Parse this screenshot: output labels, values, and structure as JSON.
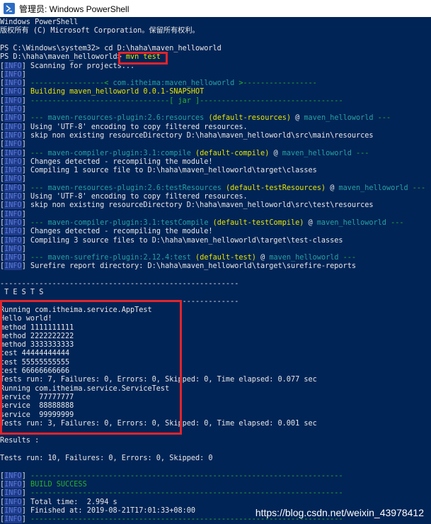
{
  "window": {
    "title": "管理员: Windows PowerShell",
    "icon": "powershell-icon"
  },
  "colors": {
    "background": "#012456",
    "highlight_border": "#e0252b",
    "info_tag": "#5b7bd6",
    "success": "#2ab52a",
    "plugin": "#2aa1a1",
    "goal": "#e6e600"
  },
  "lines": [
    {
      "parts": [
        {
          "t": "Windows PowerShell",
          "c": "w"
        }
      ]
    },
    {
      "parts": [
        {
          "t": "版权所有 (C) Microsoft Corporation。保留所有权利。",
          "c": "w"
        }
      ]
    },
    {
      "parts": [
        {
          "t": "",
          "c": "w"
        }
      ]
    },
    {
      "parts": [
        {
          "t": "PS C:\\Windows\\system32> cd D:\\haha\\maven_helloworld",
          "c": "w"
        }
      ]
    },
    {
      "parts": [
        {
          "t": "PS D:\\haha\\maven_helloworld> ",
          "c": "w"
        },
        {
          "t": "mvn test",
          "c": "y"
        }
      ]
    },
    {
      "parts": [
        {
          "t": "[",
          "c": "w"
        },
        {
          "t": "INFO",
          "c": "info"
        },
        {
          "t": "] Scanning for projects...",
          "c": "w"
        }
      ]
    },
    {
      "parts": [
        {
          "t": "[",
          "c": "w"
        },
        {
          "t": "INFO",
          "c": "info"
        },
        {
          "t": "]",
          "c": "w"
        }
      ]
    },
    {
      "parts": [
        {
          "t": "[",
          "c": "w"
        },
        {
          "t": "INFO",
          "c": "info"
        },
        {
          "t": "] ",
          "c": "w"
        },
        {
          "t": "-----------------< ",
          "c": "g"
        },
        {
          "t": "com.itheima:maven_helloworld",
          "c": "c"
        },
        {
          "t": " >-----------------",
          "c": "g"
        }
      ]
    },
    {
      "parts": [
        {
          "t": "[",
          "c": "w"
        },
        {
          "t": "INFO",
          "c": "info"
        },
        {
          "t": "] ",
          "c": "w"
        },
        {
          "t": "Building maven_helloworld 0.0.1-SNAPSHOT",
          "c": "y"
        }
      ]
    },
    {
      "parts": [
        {
          "t": "[",
          "c": "w"
        },
        {
          "t": "INFO",
          "c": "info"
        },
        {
          "t": "] ",
          "c": "w"
        },
        {
          "t": "--------------------------------[ jar ]---------------------------------",
          "c": "g"
        }
      ]
    },
    {
      "parts": [
        {
          "t": "[",
          "c": "w"
        },
        {
          "t": "INFO",
          "c": "info"
        },
        {
          "t": "]",
          "c": "w"
        }
      ]
    },
    {
      "parts": [
        {
          "t": "[",
          "c": "w"
        },
        {
          "t": "INFO",
          "c": "info"
        },
        {
          "t": "] ",
          "c": "w"
        },
        {
          "t": "--- ",
          "c": "g"
        },
        {
          "t": "maven-resources-plugin:2.6:resources",
          "c": "c"
        },
        {
          "t": " (default-resources)",
          "c": "y"
        },
        {
          "t": " @ ",
          "c": "w"
        },
        {
          "t": "maven_helloworld",
          "c": "c"
        },
        {
          "t": " ---",
          "c": "g"
        }
      ]
    },
    {
      "parts": [
        {
          "t": "[",
          "c": "w"
        },
        {
          "t": "INFO",
          "c": "info"
        },
        {
          "t": "] Using 'UTF-8' encoding to copy filtered resources.",
          "c": "w"
        }
      ]
    },
    {
      "parts": [
        {
          "t": "[",
          "c": "w"
        },
        {
          "t": "INFO",
          "c": "info"
        },
        {
          "t": "] skip non existing resourceDirectory D:\\haha\\maven_helloworld\\src\\main\\resources",
          "c": "w"
        }
      ]
    },
    {
      "parts": [
        {
          "t": "[",
          "c": "w"
        },
        {
          "t": "INFO",
          "c": "info"
        },
        {
          "t": "]",
          "c": "w"
        }
      ]
    },
    {
      "parts": [
        {
          "t": "[",
          "c": "w"
        },
        {
          "t": "INFO",
          "c": "info"
        },
        {
          "t": "] ",
          "c": "w"
        },
        {
          "t": "--- ",
          "c": "g"
        },
        {
          "t": "maven-compiler-plugin:3.1:compile",
          "c": "c"
        },
        {
          "t": " (default-compile)",
          "c": "y"
        },
        {
          "t": " @ ",
          "c": "w"
        },
        {
          "t": "maven_helloworld",
          "c": "c"
        },
        {
          "t": " ---",
          "c": "g"
        }
      ]
    },
    {
      "parts": [
        {
          "t": "[",
          "c": "w"
        },
        {
          "t": "INFO",
          "c": "info"
        },
        {
          "t": "] Changes detected - recompiling the module!",
          "c": "w"
        }
      ]
    },
    {
      "parts": [
        {
          "t": "[",
          "c": "w"
        },
        {
          "t": "INFO",
          "c": "info"
        },
        {
          "t": "] Compiling 1 source file to D:\\haha\\maven_helloworld\\target\\classes",
          "c": "w"
        }
      ]
    },
    {
      "parts": [
        {
          "t": "[",
          "c": "w"
        },
        {
          "t": "INFO",
          "c": "info"
        },
        {
          "t": "]",
          "c": "w"
        }
      ]
    },
    {
      "parts": [
        {
          "t": "[",
          "c": "w"
        },
        {
          "t": "INFO",
          "c": "info"
        },
        {
          "t": "] ",
          "c": "w"
        },
        {
          "t": "--- ",
          "c": "g"
        },
        {
          "t": "maven-resources-plugin:2.6:testResources",
          "c": "c"
        },
        {
          "t": " (default-testResources)",
          "c": "y"
        },
        {
          "t": " @ ",
          "c": "w"
        },
        {
          "t": "maven_helloworld",
          "c": "c"
        },
        {
          "t": " ---",
          "c": "g"
        }
      ]
    },
    {
      "parts": [
        {
          "t": "[",
          "c": "w"
        },
        {
          "t": "INFO",
          "c": "info"
        },
        {
          "t": "] Using 'UTF-8' encoding to copy filtered resources.",
          "c": "w"
        }
      ]
    },
    {
      "parts": [
        {
          "t": "[",
          "c": "w"
        },
        {
          "t": "INFO",
          "c": "info"
        },
        {
          "t": "] skip non existing resourceDirectory D:\\haha\\maven_helloworld\\src\\test\\resources",
          "c": "w"
        }
      ]
    },
    {
      "parts": [
        {
          "t": "[",
          "c": "w"
        },
        {
          "t": "INFO",
          "c": "info"
        },
        {
          "t": "]",
          "c": "w"
        }
      ]
    },
    {
      "parts": [
        {
          "t": "[",
          "c": "w"
        },
        {
          "t": "INFO",
          "c": "info"
        },
        {
          "t": "] ",
          "c": "w"
        },
        {
          "t": "--- ",
          "c": "g"
        },
        {
          "t": "maven-compiler-plugin:3.1:testCompile",
          "c": "c"
        },
        {
          "t": " (default-testCompile)",
          "c": "y"
        },
        {
          "t": " @ ",
          "c": "w"
        },
        {
          "t": "maven_helloworld",
          "c": "c"
        },
        {
          "t": " ---",
          "c": "g"
        }
      ]
    },
    {
      "parts": [
        {
          "t": "[",
          "c": "w"
        },
        {
          "t": "INFO",
          "c": "info"
        },
        {
          "t": "] Changes detected - recompiling the module!",
          "c": "w"
        }
      ]
    },
    {
      "parts": [
        {
          "t": "[",
          "c": "w"
        },
        {
          "t": "INFO",
          "c": "info"
        },
        {
          "t": "] Compiling 3 source files to D:\\haha\\maven_helloworld\\target\\test-classes",
          "c": "w"
        }
      ]
    },
    {
      "parts": [
        {
          "t": "[",
          "c": "w"
        },
        {
          "t": "INFO",
          "c": "info"
        },
        {
          "t": "]",
          "c": "w"
        }
      ]
    },
    {
      "parts": [
        {
          "t": "[",
          "c": "w"
        },
        {
          "t": "INFO",
          "c": "info"
        },
        {
          "t": "] ",
          "c": "w"
        },
        {
          "t": "--- ",
          "c": "g"
        },
        {
          "t": "maven-surefire-plugin:2.12.4:test",
          "c": "c"
        },
        {
          "t": " (default-test)",
          "c": "y"
        },
        {
          "t": " @ ",
          "c": "w"
        },
        {
          "t": "maven_helloworld",
          "c": "c"
        },
        {
          "t": " ---",
          "c": "g"
        }
      ]
    },
    {
      "parts": [
        {
          "t": "[",
          "c": "w"
        },
        {
          "t": "INFO",
          "c": "info"
        },
        {
          "t": "] Surefire report directory: D:\\haha\\maven_helloworld\\target\\surefire-reports",
          "c": "w"
        }
      ]
    },
    {
      "parts": [
        {
          "t": "",
          "c": "w"
        }
      ]
    },
    {
      "parts": [
        {
          "t": "-------------------------------------------------------",
          "c": "w"
        }
      ]
    },
    {
      "parts": [
        {
          "t": " T E S T S",
          "c": "w"
        }
      ]
    },
    {
      "parts": [
        {
          "t": "-------------------------------------------------------",
          "c": "w"
        }
      ]
    },
    {
      "parts": [
        {
          "t": "Running com.itheima.service.AppTest",
          "c": "w"
        }
      ]
    },
    {
      "parts": [
        {
          "t": "Hello world!",
          "c": "w"
        }
      ]
    },
    {
      "parts": [
        {
          "t": "method 1111111111",
          "c": "w"
        }
      ]
    },
    {
      "parts": [
        {
          "t": "method 2222222222",
          "c": "w"
        }
      ]
    },
    {
      "parts": [
        {
          "t": "method 3333333333",
          "c": "w"
        }
      ]
    },
    {
      "parts": [
        {
          "t": "test 44444444444",
          "c": "w"
        }
      ]
    },
    {
      "parts": [
        {
          "t": "test 55555555555",
          "c": "w"
        }
      ]
    },
    {
      "parts": [
        {
          "t": "test 66666666666",
          "c": "w"
        }
      ]
    },
    {
      "parts": [
        {
          "t": "Tests run: 7, Failures: 0, Errors: 0, Skipped: 0, Time elapsed: 0.077 sec",
          "c": "w"
        }
      ]
    },
    {
      "parts": [
        {
          "t": "Running com.itheima.service.ServiceTest",
          "c": "w"
        }
      ]
    },
    {
      "parts": [
        {
          "t": "service  77777777",
          "c": "w"
        }
      ]
    },
    {
      "parts": [
        {
          "t": "service  88888888",
          "c": "w"
        }
      ]
    },
    {
      "parts": [
        {
          "t": "service  99999999",
          "c": "w"
        }
      ]
    },
    {
      "parts": [
        {
          "t": "Tests run: 3, Failures: 0, Errors: 0, Skipped: 0, Time elapsed: 0.001 sec",
          "c": "w"
        }
      ]
    },
    {
      "parts": [
        {
          "t": "",
          "c": "w"
        }
      ]
    },
    {
      "parts": [
        {
          "t": "Results :",
          "c": "w"
        }
      ]
    },
    {
      "parts": [
        {
          "t": "",
          "c": "w"
        }
      ]
    },
    {
      "parts": [
        {
          "t": "Tests run: 10, Failures: 0, Errors: 0, Skipped: 0",
          "c": "w"
        }
      ]
    },
    {
      "parts": [
        {
          "t": "",
          "c": "w"
        }
      ]
    },
    {
      "parts": [
        {
          "t": "[",
          "c": "w"
        },
        {
          "t": "INFO",
          "c": "info"
        },
        {
          "t": "] ",
          "c": "w"
        },
        {
          "t": "------------------------------------------------------------------------",
          "c": "g"
        }
      ]
    },
    {
      "parts": [
        {
          "t": "[",
          "c": "w"
        },
        {
          "t": "INFO",
          "c": "info"
        },
        {
          "t": "] ",
          "c": "w"
        },
        {
          "t": "BUILD SUCCESS",
          "c": "g"
        }
      ]
    },
    {
      "parts": [
        {
          "t": "[",
          "c": "w"
        },
        {
          "t": "INFO",
          "c": "info"
        },
        {
          "t": "] ",
          "c": "w"
        },
        {
          "t": "------------------------------------------------------------------------",
          "c": "g"
        }
      ]
    },
    {
      "parts": [
        {
          "t": "[",
          "c": "w"
        },
        {
          "t": "INFO",
          "c": "info"
        },
        {
          "t": "] Total time:  2.994 s",
          "c": "w"
        }
      ]
    },
    {
      "parts": [
        {
          "t": "[",
          "c": "w"
        },
        {
          "t": "INFO",
          "c": "info"
        },
        {
          "t": "] Finished at: 2019-08-21T17:01:33+08:00",
          "c": "w"
        }
      ]
    },
    {
      "parts": [
        {
          "t": "[",
          "c": "w"
        },
        {
          "t": "INFO",
          "c": "info"
        },
        {
          "t": "] ",
          "c": "w"
        },
        {
          "t": "------------------------------------------------------------------------",
          "c": "g"
        }
      ]
    }
  ],
  "watermark": "https://blog.csdn.net/weixin_43978412"
}
